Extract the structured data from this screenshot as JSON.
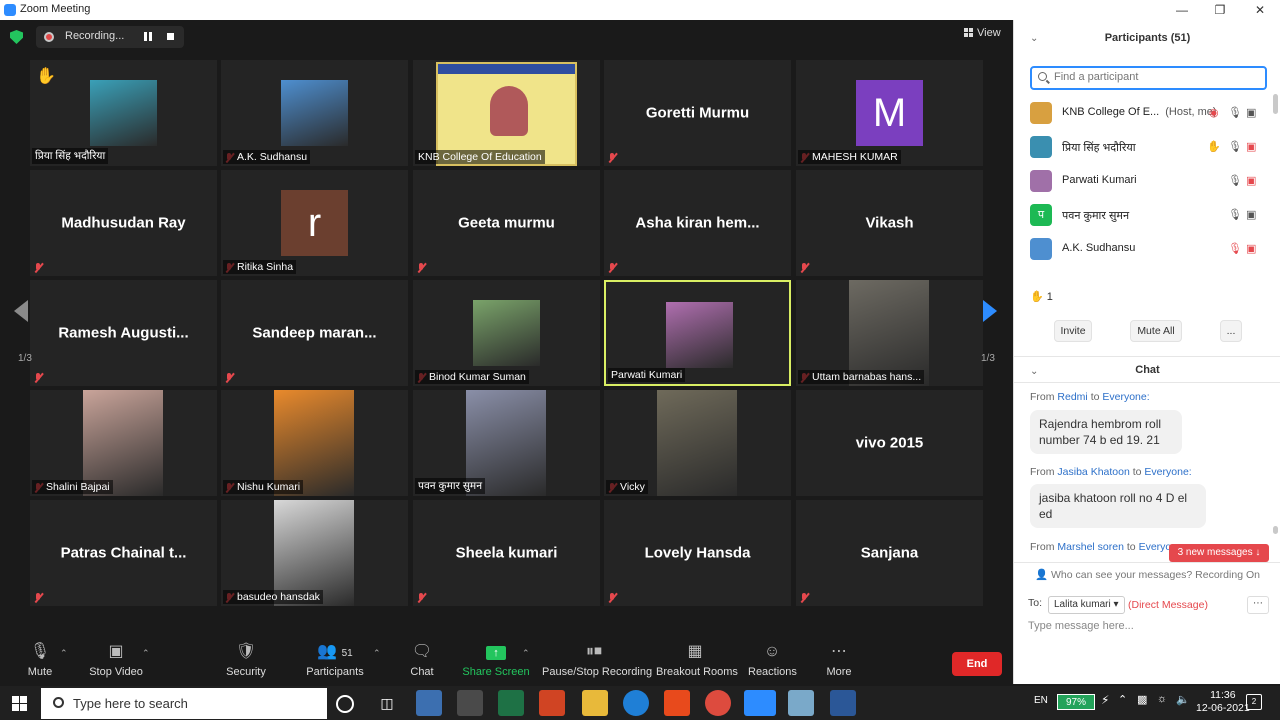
{
  "window": {
    "title": "Zoom Meeting"
  },
  "recording": {
    "label": "Recording..."
  },
  "view": {
    "label": "View"
  },
  "grid": {
    "page": "1/3",
    "tiles": [
      {
        "name": "प्रिया सिंह भदौरिया",
        "type": "photo",
        "photo_color": "#3aa0b8",
        "mic_off": false,
        "hand": true
      },
      {
        "name": "A.K. Sudhansu",
        "type": "photo",
        "photo_color": "#4e8fd0",
        "mic_off": true
      },
      {
        "name": "KNB College Of Education",
        "type": "slide",
        "mic_off": false
      },
      {
        "name": "Goretti Murmu",
        "type": "name",
        "mic_off": true
      },
      {
        "name": "MAHESH KUMAR",
        "type": "letter",
        "letter": "M",
        "letter_color": "#7b3fbf",
        "mic_off": true
      },
      {
        "name": "Madhusudan Ray",
        "type": "name",
        "mic_off": true
      },
      {
        "name": "Ritika Sinha",
        "type": "letter",
        "letter": "r",
        "letter_color": "#6b3f2f",
        "mic_off": true
      },
      {
        "name": "Geeta murmu",
        "type": "name",
        "mic_off": true
      },
      {
        "name": "Asha kiran hem...",
        "type": "name",
        "mic_off": true
      },
      {
        "name": "Vikash",
        "type": "name",
        "mic_off": true
      },
      {
        "name": "Ramesh Augusti...",
        "type": "name",
        "mic_off": true
      },
      {
        "name": "Sandeep maran...",
        "type": "name",
        "mic_off": true
      },
      {
        "name": "Binod Kumar Suman",
        "type": "photo",
        "photo_color": "#7aa36a",
        "mic_off": true
      },
      {
        "name": "Parwati Kumari",
        "type": "photo",
        "photo_color": "#b06fb0",
        "mic_off": false,
        "active": true
      },
      {
        "name": "Uttam barnabas hans...",
        "type": "photo",
        "photo_color": "#6d6a62",
        "mic_off": true,
        "wide": true
      },
      {
        "name": "Shalini Bajpai",
        "type": "photo",
        "photo_color": "#c9a49a",
        "mic_off": true
      },
      {
        "name": "Nishu Kumari",
        "type": "photo",
        "photo_color": "#e98a2c",
        "mic_off": true
      },
      {
        "name": "पवन कुमार सुमन",
        "type": "photo",
        "photo_color": "#8a8fa8",
        "mic_off": false
      },
      {
        "name": "Vicky",
        "type": "photo",
        "photo_color": "#6f6a5a",
        "mic_off": true
      },
      {
        "name": "vivo 2015",
        "type": "name",
        "mic_off": false
      },
      {
        "name": "Patras Chainal t...",
        "type": "name",
        "mic_off": true
      },
      {
        "name": "basudeo hansdak",
        "type": "photo",
        "photo_color": "#d8d8d8",
        "mic_off": true
      },
      {
        "name": "Sheela kumari",
        "type": "name",
        "mic_off": true
      },
      {
        "name": "Lovely Hansda",
        "type": "name",
        "mic_off": true
      },
      {
        "name": "Sanjana",
        "type": "name",
        "mic_off": true
      }
    ]
  },
  "toolbar": {
    "mute": "Mute",
    "stop_video": "Stop Video",
    "security": "Security",
    "participants": "Participants",
    "participants_count": "51",
    "chat": "Chat",
    "share_screen": "Share Screen",
    "pause_stop_recording": "Pause/Stop Recording",
    "breakout_rooms": "Breakout Rooms",
    "reactions": "Reactions",
    "more": "More",
    "end": "End"
  },
  "participants_panel": {
    "title": "Participants (51)",
    "search_placeholder": "Find a participant",
    "list": [
      {
        "name": "KNB College Of E...",
        "role": "(Host, me)",
        "avatar_color": "#d8a040",
        "avatar": ""
      },
      {
        "name": "प्रिया सिंह भदौरिया",
        "role": "",
        "avatar_color": "#3a8fb0",
        "avatar": ""
      },
      {
        "name": "Parwati Kumari",
        "role": "",
        "avatar_color": "#a070a8",
        "avatar": ""
      },
      {
        "name": "पवन कुमार सुमन",
        "role": "",
        "avatar_color": "#1db954",
        "avatar": "प"
      },
      {
        "name": "A.K. Sudhansu",
        "role": "",
        "avatar_color": "#4e8fd0",
        "avatar": ""
      }
    ],
    "raised_hands": "1",
    "invite": "Invite",
    "mute_all": "Mute All",
    "more": "..."
  },
  "chat": {
    "title": "Chat",
    "messages": [
      {
        "from_prefix": "From",
        "from": "Redmi",
        "to_prefix": "to",
        "to": "Everyone:",
        "text": "Rajendra hembrom roll number 74    b ed 19. 21"
      },
      {
        "from_prefix": "From",
        "from": "Jasiba Khatoon",
        "to_prefix": "to",
        "to": "Everyone:",
        "text": "jasiba khatoon roll no 4 D el ed"
      },
      {
        "from_prefix": "From",
        "from": "Marshel soren",
        "to_prefix": "to",
        "to": "Everyo",
        "text": ""
      }
    ],
    "new_messages": "3 new messages ↓",
    "visibility": "Who can see your messages? Recording On",
    "to_label": "To:",
    "recipient": "Lalita kumari ▾",
    "direct_message": "(Direct Message)",
    "input_placeholder": "Type message here..."
  },
  "taskbar": {
    "search_placeholder": "Type here to search",
    "language": "EN",
    "battery": "97%",
    "time": "11:36",
    "date": "12-06-2021",
    "notifications": "2"
  }
}
